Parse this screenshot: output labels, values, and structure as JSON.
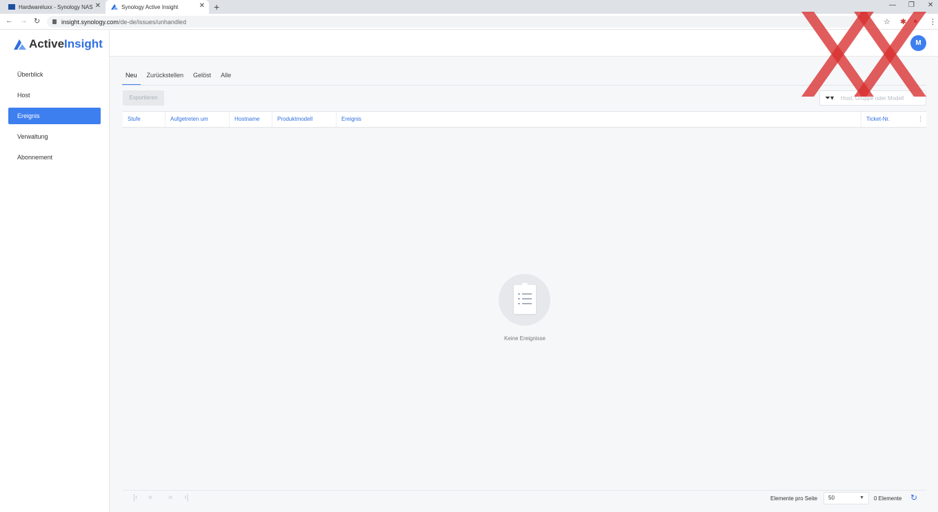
{
  "browser": {
    "tabs": [
      {
        "title": "Hardwareluxx - Synology NAS"
      },
      {
        "title": "Synology Active Insight"
      }
    ],
    "url_host": "insight.synology.com",
    "url_path": "/de-de/issues/unhandled"
  },
  "logo": {
    "part1": "Active",
    "part2": "Insight"
  },
  "sidebar": {
    "items": [
      {
        "label": "Überblick"
      },
      {
        "label": "Host"
      },
      {
        "label": "Ereignis"
      },
      {
        "label": "Verwaltung"
      },
      {
        "label": "Abonnement"
      }
    ]
  },
  "header": {
    "avatar_initial": "M"
  },
  "tabs": [
    {
      "label": "Neu"
    },
    {
      "label": "Zurückstellen"
    },
    {
      "label": "Gelöst"
    },
    {
      "label": "Alle"
    }
  ],
  "toolbar": {
    "export_label": "Exportieren",
    "search_placeholder": "Host, Gruppe oder Modell"
  },
  "table": {
    "columns": [
      "Stufe",
      "Aufgetreten um",
      "Hostname",
      "Produktmodell",
      "Ereignis",
      "Ticket-Nr."
    ]
  },
  "empty_state": {
    "message": "Keine Ereignisse"
  },
  "footer": {
    "per_page_label": "Elemente pro Seite",
    "per_page_value": "50",
    "count_label": "0 Elemente"
  },
  "colors": {
    "accent": "#3e7ff0",
    "overlay": "#d9302f"
  }
}
